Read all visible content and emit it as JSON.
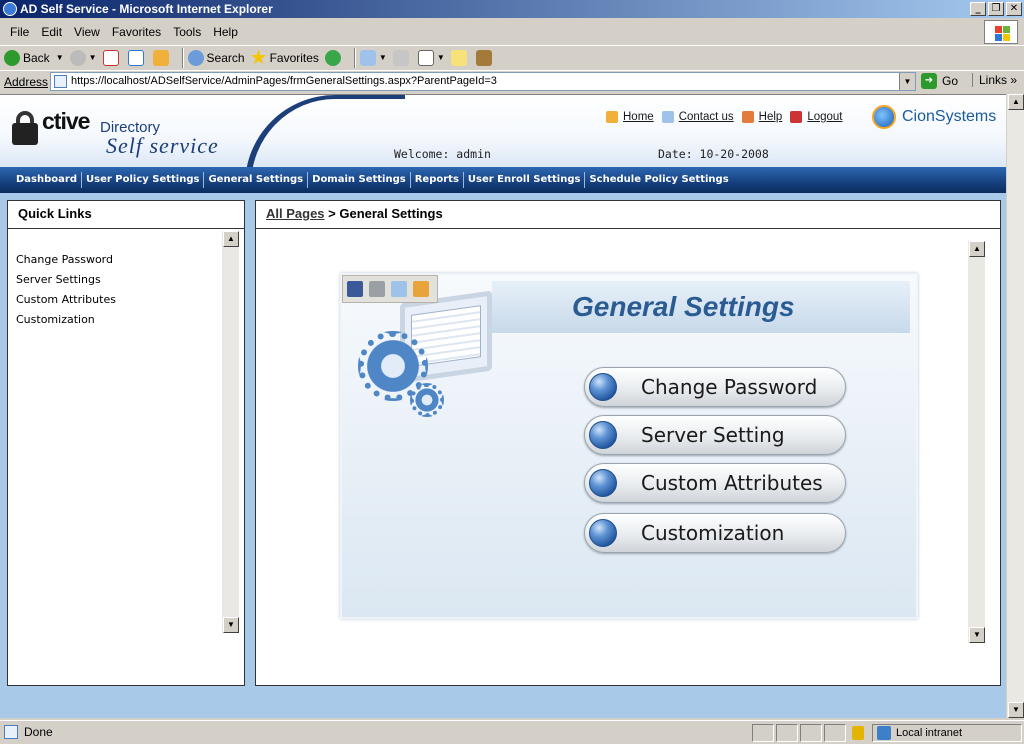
{
  "window": {
    "title": "AD Self Service - Microsoft Internet Explorer"
  },
  "menu": [
    "File",
    "Edit",
    "View",
    "Favorites",
    "Tools",
    "Help"
  ],
  "toolbar": {
    "back": "Back",
    "search": "Search",
    "favorites": "Favorites"
  },
  "address": {
    "label": "Address",
    "url": "https://localhost/ADSelfService/AdminPages/frmGeneralSettings.aspx?ParentPageId=3",
    "go": "Go",
    "links": "Links"
  },
  "header": {
    "logo": {
      "ctive": "ctive",
      "directory": "Directory",
      "selfservice": "Self service"
    },
    "links": [
      "Home",
      "Contact us",
      "Help",
      "Logout"
    ],
    "brand": "CionSystems",
    "welcome": "Welcome: admin",
    "date": "Date: 10-20-2008"
  },
  "nav": [
    "Dashboard",
    "User Policy Settings",
    "General Settings",
    "Domain Settings",
    "Reports",
    "User Enroll Settings",
    "Schedule Policy Settings"
  ],
  "quick_links": {
    "title": "Quick Links",
    "items": [
      "Change Password",
      "Server Settings",
      "Custom Attributes",
      "Customization"
    ]
  },
  "main": {
    "breadcrumb_link": "All Pages",
    "breadcrumb_sep": " > ",
    "breadcrumb_current": "General Settings",
    "panel_title": "General Settings",
    "buttons": [
      "Change Password",
      "Server Setting",
      "Custom Attributes",
      "Customization"
    ]
  },
  "status": {
    "text": "Done",
    "zone": "Local intranet"
  },
  "colors": {
    "nav_bg": "#16407e",
    "accent": "#2a5c93",
    "titlebar": "#0a246a",
    "content_bg": "#a9c9e9"
  }
}
